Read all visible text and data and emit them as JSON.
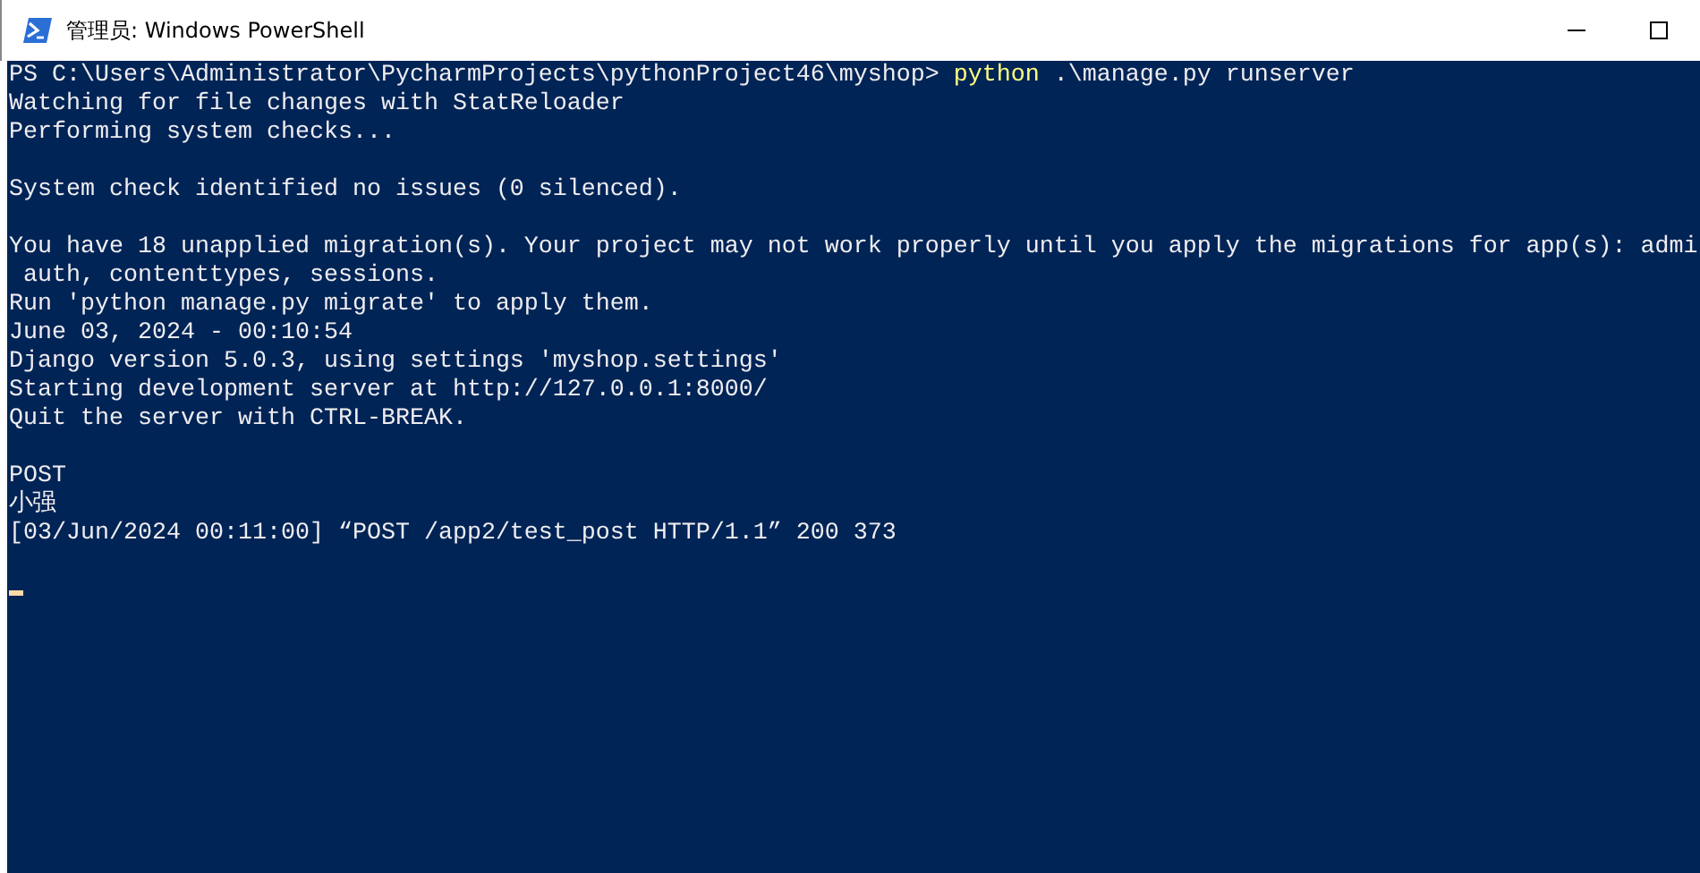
{
  "window": {
    "title": "管理员: Windows PowerShell"
  },
  "console": {
    "lines": [
      {
        "kind": "text",
        "segments": [
          {
            "kind": "plain",
            "text": "PS C:\\Users\\Administrator\\PycharmProjects\\pythonProject46\\myshop> "
          },
          {
            "kind": "command",
            "text": "python"
          },
          {
            "kind": "plain",
            "text": " .\\manage.py runserver"
          }
        ]
      },
      {
        "kind": "text",
        "segments": [
          {
            "kind": "plain",
            "text": "Watching for file changes with StatReloader"
          }
        ]
      },
      {
        "kind": "text",
        "segments": [
          {
            "kind": "plain",
            "text": "Performing system checks..."
          }
        ]
      },
      {
        "kind": "blank"
      },
      {
        "kind": "text",
        "segments": [
          {
            "kind": "plain",
            "text": "System check identified no issues (0 silenced)."
          }
        ]
      },
      {
        "kind": "blank"
      },
      {
        "kind": "text",
        "segments": [
          {
            "kind": "plain",
            "text": "You have 18 unapplied migration(s). Your project may not work properly until you apply the migrations for app(s): admi"
          }
        ]
      },
      {
        "kind": "text",
        "segments": [
          {
            "kind": "plain",
            "text": " auth, contenttypes, sessions."
          }
        ]
      },
      {
        "kind": "text",
        "segments": [
          {
            "kind": "plain",
            "text": "Run 'python manage.py migrate' to apply them."
          }
        ]
      },
      {
        "kind": "text",
        "segments": [
          {
            "kind": "plain",
            "text": "June 03, 2024 - 00:10:54"
          }
        ]
      },
      {
        "kind": "text",
        "segments": [
          {
            "kind": "plain",
            "text": "Django version 5.0.3, using settings 'myshop.settings'"
          }
        ]
      },
      {
        "kind": "text",
        "segments": [
          {
            "kind": "plain",
            "text": "Starting development server at http://127.0.0.1:8000/"
          }
        ]
      },
      {
        "kind": "text",
        "segments": [
          {
            "kind": "plain",
            "text": "Quit the server with CTRL-BREAK."
          }
        ]
      },
      {
        "kind": "blank"
      },
      {
        "kind": "text",
        "segments": [
          {
            "kind": "plain",
            "text": "POST"
          }
        ]
      },
      {
        "kind": "text",
        "segments": [
          {
            "kind": "plain",
            "text": "小强"
          }
        ]
      },
      {
        "kind": "text",
        "segments": [
          {
            "kind": "plain",
            "text": "[03/Jun/2024 00:11:00] “POST /app2/test_post HTTP/1.1” 200 373"
          }
        ]
      },
      {
        "kind": "blank"
      },
      {
        "kind": "cursor"
      }
    ]
  }
}
